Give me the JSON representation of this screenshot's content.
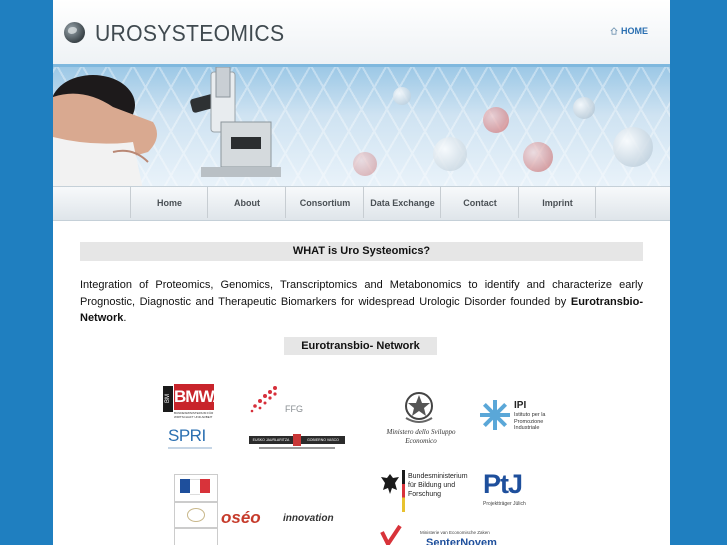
{
  "header": {
    "site_title": "UROSYSTEOMICS",
    "home_link": "HOME"
  },
  "nav": {
    "items": [
      {
        "label": "Home"
      },
      {
        "label": "About"
      },
      {
        "label": "Consortium"
      },
      {
        "label": "Data Exchange"
      },
      {
        "label": "Contact"
      },
      {
        "label": "Imprint"
      }
    ]
  },
  "content": {
    "title": "WHAT is Uro Systeomics?",
    "intro_text": "Integration of Proteomics, Genomics, Transcriptomics and Metabonomics to identify and characterize early Prognostic, Diagnostic and Therapeutic Biomarkers for widespread Urologic Disorder founded by ",
    "intro_bold": "Eurotransbio-Network",
    "intro_end": ".",
    "network_title": "Eurotransbio- Network"
  },
  "logos": {
    "bmwa": {
      "main": "BMWA",
      "vertical": "BM",
      "sub": "BUNDESMINISTERIUM FÜR WIRTSCHAFT UND ARBEIT"
    },
    "ffg": {
      "text": "FFG"
    },
    "ministero": {
      "text": "Ministero dello Sviluppo Economico"
    },
    "ipi": {
      "title": "IPI",
      "sub": "Istituto per la Promozione Industriale"
    },
    "spri": {
      "text": "SPRI"
    },
    "basque": {
      "left": "EUSKO JAURLARITZA",
      "right": "GOBIERNO VASCO"
    },
    "bmbf": {
      "text": "Bundesministerium für Bildung und Forschung"
    },
    "ptj": {
      "text": "PtJ",
      "sub": "Projektträger Jülich"
    },
    "oseo": {
      "main": "oséo",
      "tag": "innovation"
    },
    "senter": {
      "top": "Ministerie van Economische Zaken",
      "main": "SenterNovem"
    }
  },
  "colors": {
    "background": "#1f7fc0",
    "nav_text": "#4a5055",
    "link_blue": "#2a6fb1",
    "bmwa_red": "#c8242b",
    "ptj_blue": "#1e4f9c"
  }
}
